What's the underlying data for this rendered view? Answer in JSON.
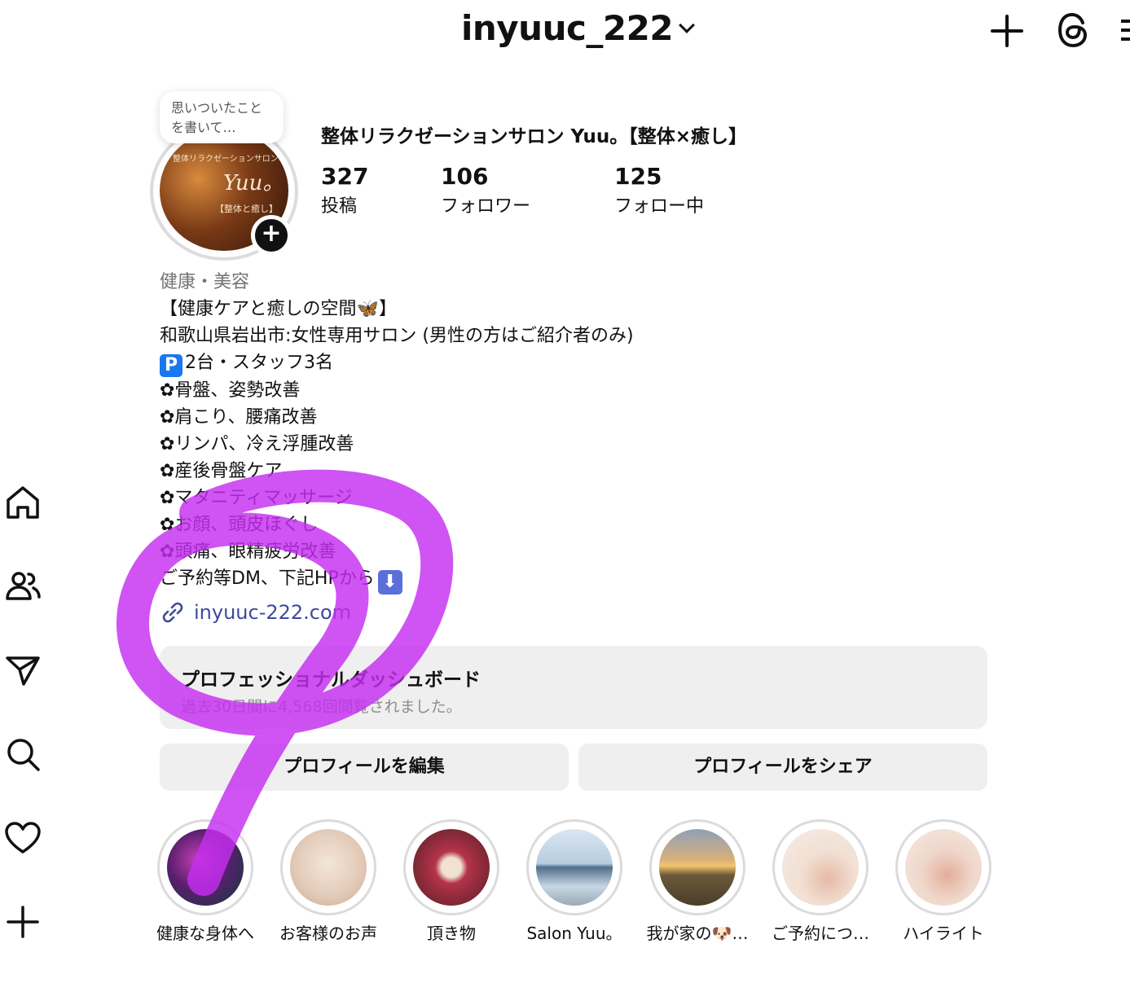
{
  "header": {
    "username": "inyuuc_222",
    "icons": [
      "plus-icon",
      "threads-icon",
      "menu-icon",
      "chevron-down-icon"
    ]
  },
  "note": {
    "text": "思いついたことを書いて…"
  },
  "avatar": {
    "line1": "整体リラクゼーションサロン",
    "title": "Yuu。",
    "tag": "【整体と癒し】"
  },
  "profile": {
    "display_name": "整体リラクゼーションサロン Yuu。【整体×癒し】",
    "stats": {
      "posts": {
        "count": "327",
        "label": "投稿"
      },
      "followers": {
        "count": "106",
        "label": "フォロワー"
      },
      "following": {
        "count": "125",
        "label": "フォロー中"
      }
    }
  },
  "bio": {
    "category": "健康・美容",
    "line1": "【健康ケアと癒しの空間",
    "line1_end": "】",
    "line2": "和歌山県岩出市:女性専用サロン (男性の方はご紹介者のみ)",
    "line3_badge": "P",
    "line3": "2台・スタッフ3名",
    "items": [
      "✿骨盤、姿勢改善",
      "✿肩こり、腰痛改善",
      "✿リンパ、冷え浮腫改善",
      "✿産後骨盤ケア",
      "✿マタニティマッサージ",
      "✿お顔、頭皮ほぐし",
      "✿頭痛、眼精疲労改善"
    ],
    "line_last": "ご予約等DM、下記HPから",
    "link": "inyuuc-222.com"
  },
  "dashboard": {
    "title": "プロフェッショナルダッシュボード",
    "subtitle": "過去30日間に4,568回閲覧されました。"
  },
  "buttons": {
    "edit": "プロフィールを編集",
    "share": "プロフィールをシェア"
  },
  "highlights": [
    {
      "label": "健康な身体へ"
    },
    {
      "label": "お客様のお声"
    },
    {
      "label": "頂き物"
    },
    {
      "label": "Salon Yuu。"
    },
    {
      "label": "我が家の🐶…"
    },
    {
      "label": "ご予約につ…"
    },
    {
      "label": "ハイライト"
    }
  ],
  "sidebar": [
    "home-icon",
    "people-icon",
    "send-icon",
    "search-icon",
    "heart-icon",
    "plus-icon"
  ],
  "colors": {
    "annotation": "#c42ef0",
    "link": "#3d4a9b",
    "badge": "#1877f2"
  }
}
